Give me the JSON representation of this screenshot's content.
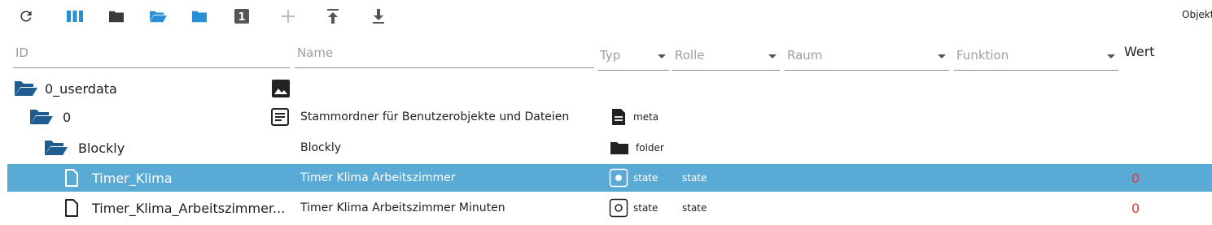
{
  "toolbar": {
    "objekt_label": "Objekt",
    "buttons": [
      {
        "name": "refresh-icon"
      },
      {
        "name": "columns-icon"
      },
      {
        "name": "folder-closed-icon"
      },
      {
        "name": "folder-open-icon"
      },
      {
        "name": "folder-icon"
      },
      {
        "name": "number-one-icon",
        "text": "1"
      },
      {
        "name": "add-icon"
      },
      {
        "name": "upload-icon"
      },
      {
        "name": "download-icon"
      }
    ]
  },
  "filters": {
    "id": "ID",
    "name": "Name",
    "typ": "Typ",
    "rolle": "Rolle",
    "raum": "Raum",
    "funktion": "Funktion",
    "wert": "Wert"
  },
  "colors": {
    "selection": "#5aaad6",
    "folder": "#1f5c8f",
    "value": "#e53935"
  },
  "rows": [
    {
      "id": "0_userdata",
      "name": "",
      "type": "",
      "role": "",
      "value": "",
      "icon": "folder-open-icon",
      "name_icon": "image-icon"
    },
    {
      "id": "0",
      "name": "Stammordner für Benutzerobjekte und Dateien",
      "type": "meta",
      "role": "",
      "value": "",
      "icon": "folder-open-icon",
      "name_icon": "text-icon"
    },
    {
      "id": "Blockly",
      "name": "Blockly",
      "type": "folder",
      "role": "",
      "value": "",
      "icon": "folder-open-icon"
    },
    {
      "id": "Timer_Klima",
      "name": "Timer Klima Arbeitszimmer",
      "type": "state",
      "role": "state",
      "value": "0",
      "icon": "file-icon",
      "selected": true
    },
    {
      "id": "Timer_Klima_Arbeitszimmer...",
      "name": "Timer Klima Arbeitszimmer Minuten",
      "type": "state",
      "role": "state",
      "value": "0",
      "icon": "file-icon"
    }
  ]
}
